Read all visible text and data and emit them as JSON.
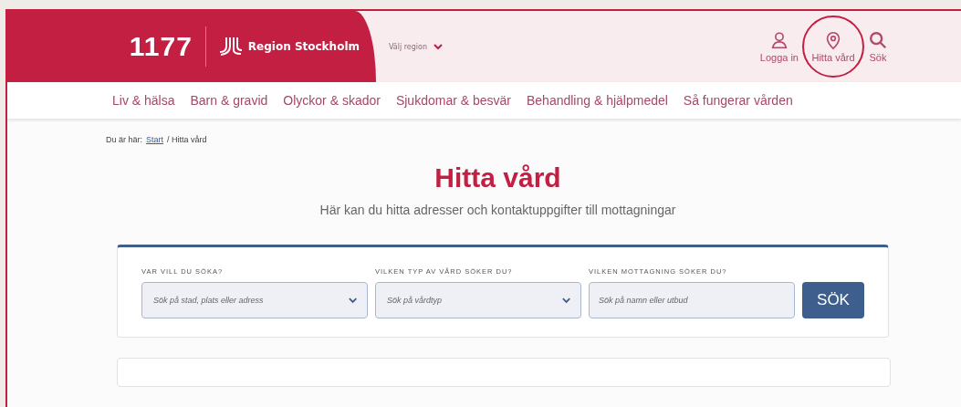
{
  "header": {
    "logo": "1177",
    "region_logo": "Region Stockholm",
    "region_select": "Välj region",
    "actions": [
      {
        "kind": "user",
        "label": "Logga in",
        "highlighted": false
      },
      {
        "kind": "pin",
        "label": "Hitta vård",
        "highlighted": true
      },
      {
        "kind": "search",
        "label": "Sök",
        "highlighted": false
      }
    ]
  },
  "nav": [
    "Liv & hälsa",
    "Barn & gravid",
    "Olyckor & skador",
    "Sjukdomar & besvär",
    "Behandling & hjälpmedel",
    "Så fungerar vården"
  ],
  "breadcrumb": {
    "prefix": "Du är här:",
    "link": "Start",
    "current": "/ Hitta vård"
  },
  "title": "Hitta vård",
  "subtitle": "Här kan du hitta adresser och kontaktuppgifter till mottagningar",
  "search": {
    "fields": [
      {
        "kind": "select",
        "label": "VAR VILL DU SÖKA?",
        "placeholder": "Sök på stad, plats eller adress"
      },
      {
        "kind": "select",
        "label": "VILKEN TYP AV VÅRD SÖKER DU?",
        "placeholder": "Sök på vårdtyp"
      },
      {
        "kind": "text",
        "label": "VILKEN MOTTAGNING SÖKER DU?",
        "placeholder": "Sök på namn eller utbud"
      }
    ],
    "button": "SÖK"
  }
}
